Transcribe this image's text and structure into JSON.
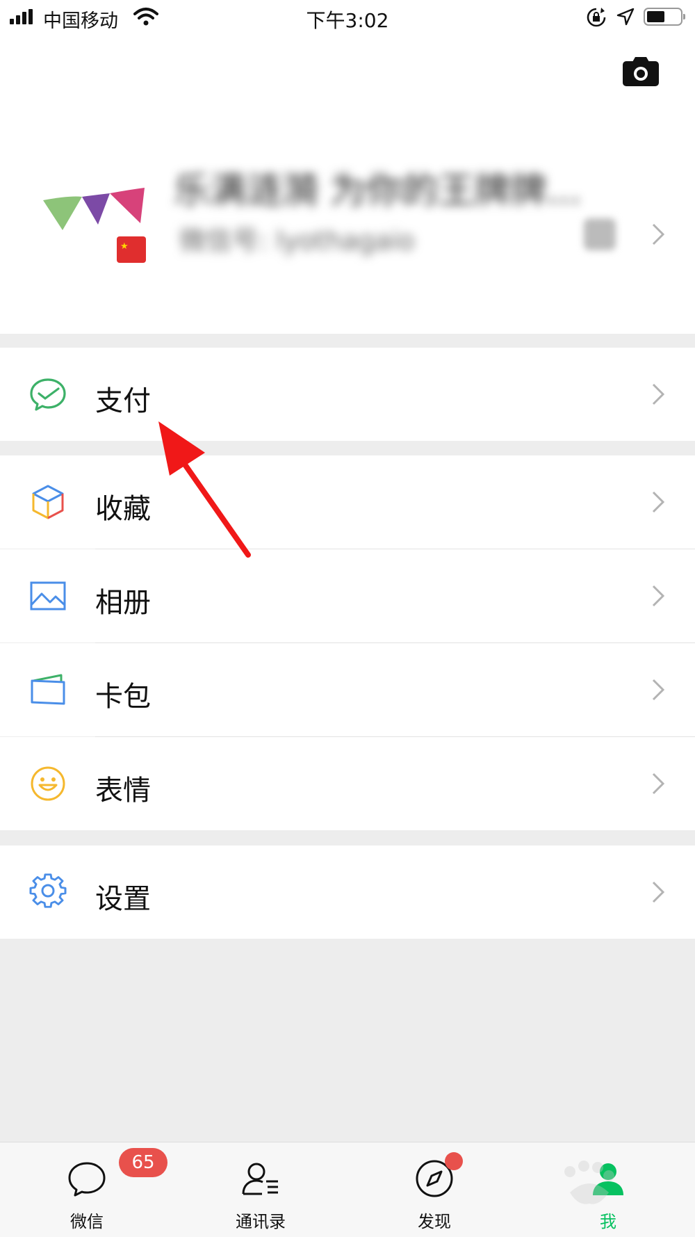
{
  "status_bar": {
    "carrier": "中国移动",
    "time": "下午3:02",
    "icons": [
      "signal-icon",
      "wifi-icon",
      "orientation-lock-icon",
      "location-icon",
      "battery-icon"
    ]
  },
  "profile": {
    "nickname": "乐满涟漪 为你的王牌牌...",
    "wechat_id": "微信号: lyothagaio",
    "flag": "china-flag-icon"
  },
  "menu": {
    "pay": "支付",
    "favorites": "收藏",
    "album": "相册",
    "cards": "卡包",
    "stickers": "表情",
    "settings": "设置"
  },
  "tabbar": {
    "chats": "微信",
    "chats_badge": "65",
    "contacts": "通讯录",
    "discover": "发现",
    "me": "我"
  },
  "colors": {
    "accent_green": "#07c160",
    "badge_red": "#e8514c",
    "annotation_arrow": "#f01818"
  }
}
